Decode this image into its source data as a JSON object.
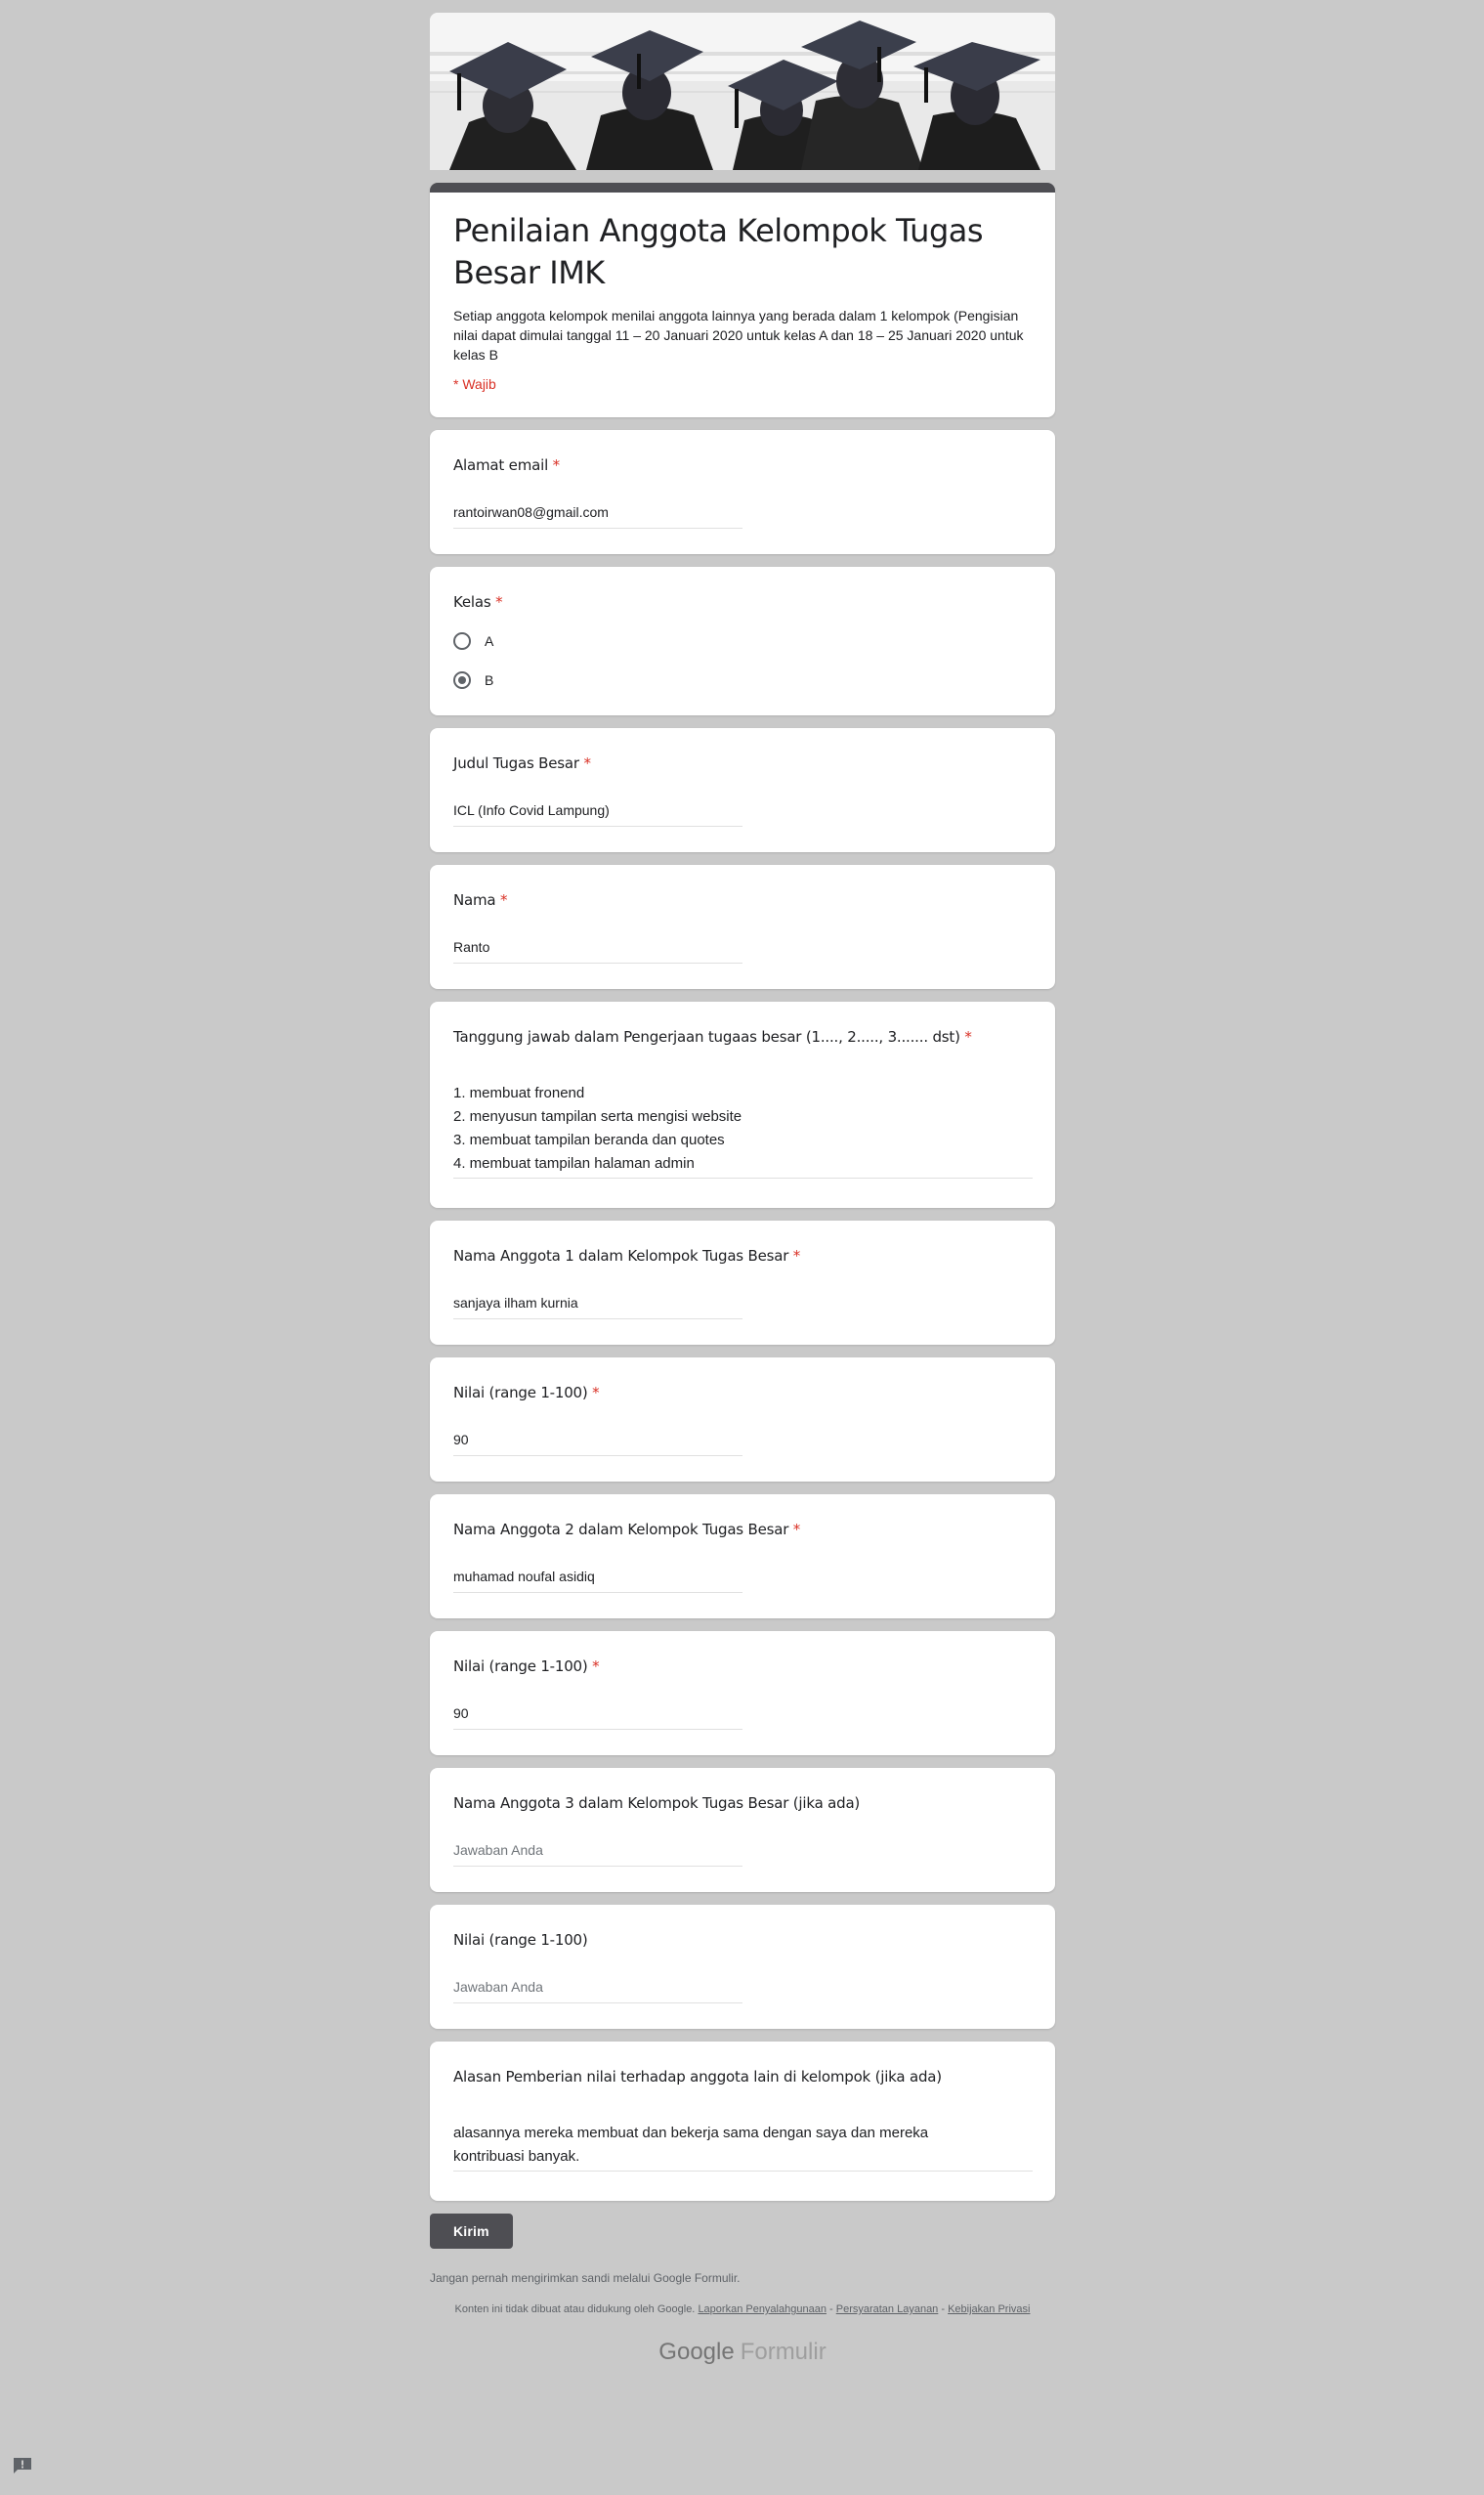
{
  "header": {
    "title": "Penilaian Anggota Kelompok Tugas Besar IMK",
    "description": "Setiap anggota kelompok menilai anggota lainnya yang berada dalam 1 kelompok (Pengisian nilai dapat dimulai tanggal 11 – 20 Januari 2020 untuk kelas A dan 18 – 25 Januari 2020 untuk kelas B",
    "required_note": "* Wajib"
  },
  "required_star": "*",
  "questions": {
    "email": {
      "label": "Alamat email",
      "value": "rantoirwan08@gmail.com"
    },
    "kelas": {
      "label": "Kelas",
      "options": [
        "A",
        "B"
      ],
      "selected": "B"
    },
    "judul": {
      "label": "Judul Tugas Besar",
      "value": "ICL (Info Covid Lampung)"
    },
    "nama": {
      "label": "Nama",
      "value": "Ranto"
    },
    "tanggung_jawab": {
      "label": "Tanggung jawab dalam Pengerjaan tugaas besar (1...., 2....., 3....... dst)",
      "lines": [
        "1. membuat fronend",
        "2. menyusun tampilan serta mengisi website",
        "3. membuat tampilan beranda dan quotes",
        "4. membuat tampilan halaman admin"
      ]
    },
    "anggota1": {
      "label": "Nama Anggota 1 dalam Kelompok Tugas Besar",
      "value": "sanjaya ilham kurnia"
    },
    "nilai1": {
      "label": "Nilai (range 1-100)",
      "value": "90"
    },
    "anggota2": {
      "label": "Nama Anggota 2 dalam Kelompok Tugas Besar",
      "value": "muhamad noufal asidiq"
    },
    "nilai2": {
      "label": "Nilai (range 1-100)",
      "value": "90"
    },
    "anggota3": {
      "label": "Nama Anggota 3 dalam Kelompok Tugas Besar (jika ada)",
      "placeholder": "Jawaban Anda"
    },
    "nilai3": {
      "label": "Nilai (range 1-100)",
      "placeholder": "Jawaban Anda"
    },
    "alasan": {
      "label": "Alasan Pemberian nilai terhadap anggota lain di kelompok (jika ada)",
      "lines": [
        "alasannya mereka membuat dan bekerja sama dengan saya dan mereka",
        "kontribuasi banyak."
      ]
    }
  },
  "submit_label": "Kirim",
  "never_password": "Jangan pernah mengirimkan sandi melalui Google Formulir.",
  "footer": {
    "disclaimer": "Konten ini tidak dibuat atau didukung oleh Google.",
    "link_report": "Laporkan Penyalahgunaan",
    "sep": " - ",
    "link_terms": "Persyaratan Layanan",
    "link_privacy": "Kebijakan Privasi"
  },
  "brand": {
    "google": "Google",
    "forms": "Formulir"
  },
  "icons": {
    "feedback": "report-feedback-icon"
  },
  "colors": {
    "theme": "#4e4e53",
    "background": "#c9c9c9",
    "required": "#d93025"
  }
}
